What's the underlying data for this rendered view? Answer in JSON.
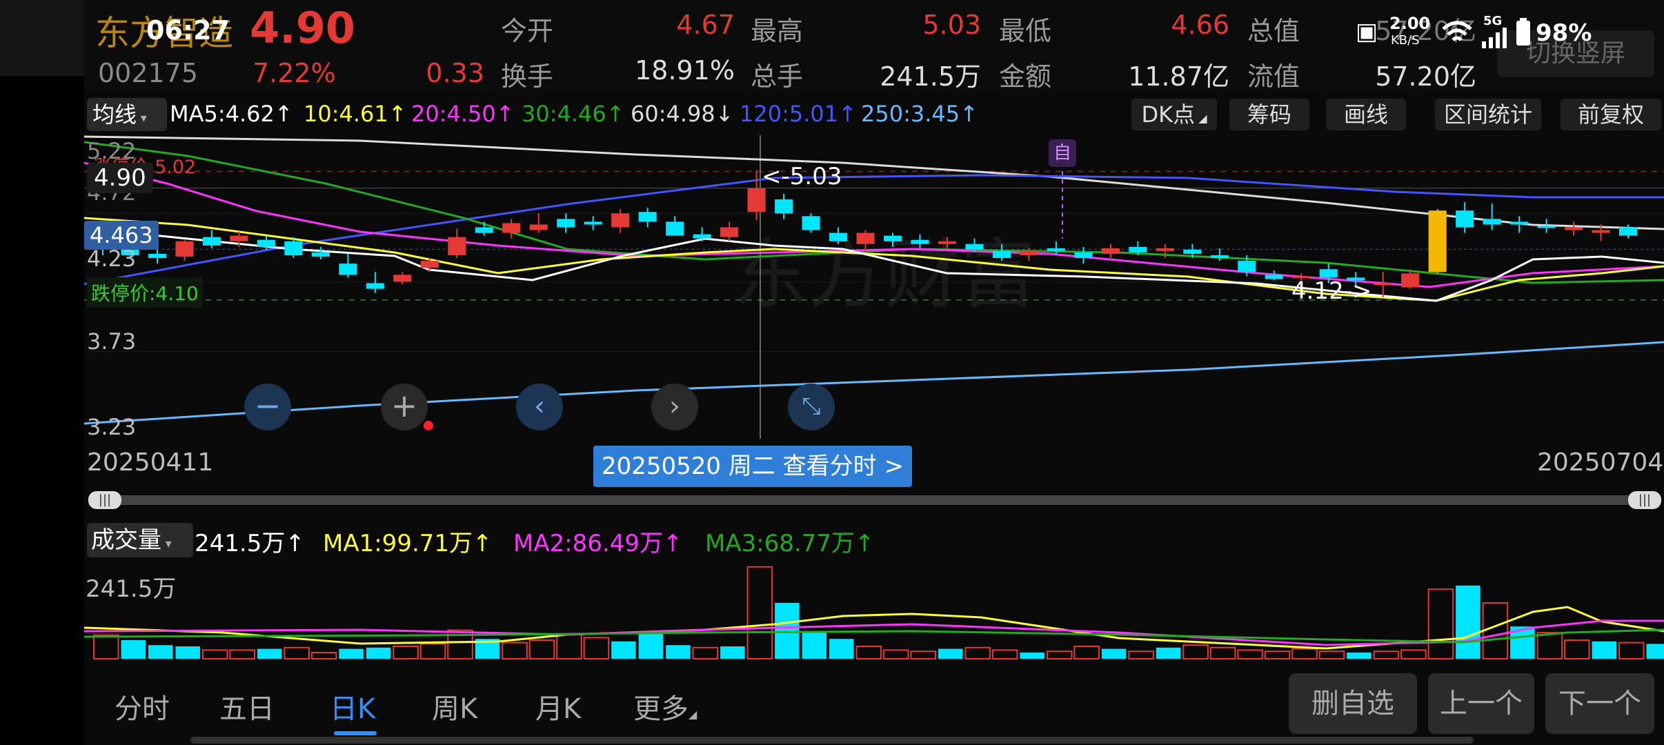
{
  "status_bar": {
    "time": "06:27",
    "net_speed": "2.00",
    "net_unit": "KB/S",
    "signal": "5G",
    "battery": "98%"
  },
  "stock": {
    "name": "东方智造",
    "price": "4.90",
    "code": "002175",
    "change_pct": "7.22%",
    "change_amt": "0.33"
  },
  "quote": {
    "open_label": "今开",
    "open": "4.67",
    "high_label": "最高",
    "high": "5.03",
    "low_label": "最低",
    "low": "4.66",
    "total_cap_label": "总值",
    "total_cap": "57.20亿",
    "turnover_label": "换手",
    "turnover": "18.91%",
    "volume_label": "总手",
    "volume": "241.5万",
    "amount_label": "金额",
    "amount": "11.87亿",
    "float_cap_label": "流值",
    "float_cap": "57.20亿",
    "switch_label": "切换竖屏"
  },
  "ma_bar": {
    "selector": "均线",
    "ma5": "MA5:4.62↑",
    "ma10": "10:4.61↑",
    "ma20": "20:4.50↑",
    "ma30": "30:4.46↑",
    "ma60": "60:4.98↓",
    "ma120": "120:5.01↑",
    "ma250": "250:3.45↑",
    "colors": {
      "ma5": "#ffffff",
      "ma10": "#ffff33",
      "ma20": "#ff33ff",
      "ma30": "#22aa22",
      "ma60": "#dddddd",
      "ma120": "#4455ff",
      "ma250": "#66bbff"
    }
  },
  "toolbar": {
    "dk": "DK点",
    "chips": "筹码",
    "draw": "画线",
    "range_stats": "区间统计",
    "adjust": "前复权"
  },
  "price_chart": {
    "y_labels": [
      "5.22",
      "4.72",
      "4.23",
      "3.73",
      "3.23"
    ],
    "current_price_tag": "4.90",
    "cursor_price_tag": "4.463",
    "limit_up": "涨停价:5.02",
    "limit_down": "跌停价:4.10",
    "high_mark": "<-5.03",
    "low_mark": "4.12->",
    "self_mark": "自",
    "date_start": "20250411",
    "date_end": "20250704",
    "cursor_tip": "20250520 周二 查看分时 >",
    "watermark": "东方财富"
  },
  "volume": {
    "selector": "成交量",
    "current": "241.5万↑",
    "ma1": "MA1:99.71万↑",
    "ma2": "MA2:86.49万↑",
    "ma3": "MA3:68.77万↑",
    "y_label": "241.5万"
  },
  "tabs": [
    "分时",
    "五日",
    "日K",
    "周K",
    "月K",
    "更多"
  ],
  "active_tab": "日K",
  "buttons": {
    "remove_watch": "删自选",
    "prev": "上一个",
    "next": "下一个"
  },
  "colors": {
    "up": "#e53935",
    "down": "#00e5ff",
    "accent": "#2f7fd9"
  }
}
